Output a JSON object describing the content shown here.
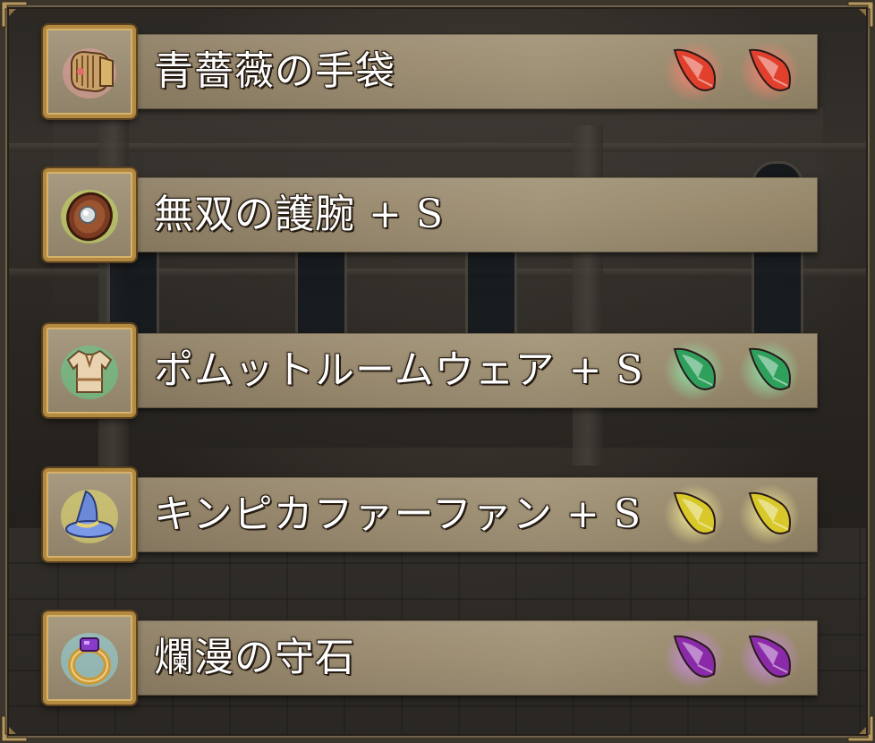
{
  "equipment_list": {
    "items": [
      {
        "name": "青薔薇の手袋",
        "icon": "gauntlet-icon",
        "icon_glow": "#e8a0a0",
        "gem_color": "red",
        "gem_count": 2,
        "gem_fill": "#e0402c",
        "gem_glow": "#ff8070"
      },
      {
        "name": "無双の護腕 + S",
        "icon": "shield-icon",
        "icon_glow": "#c8e060",
        "gem_color": "none",
        "gem_count": 0,
        "gem_fill": "",
        "gem_glow": ""
      },
      {
        "name": "ポムットルームウェア + S",
        "icon": "tunic-icon",
        "icon_glow": "#5fcf8a",
        "gem_color": "green",
        "gem_count": 2,
        "gem_fill": "#2f9f5c",
        "gem_glow": "#8ff0b0"
      },
      {
        "name": "キンピカファーファン + S",
        "icon": "wizard-hat-icon",
        "icon_glow": "#e8e070",
        "gem_color": "yellow",
        "gem_count": 2,
        "gem_fill": "#d8c82a",
        "gem_glow": "#fff59a"
      },
      {
        "name": "爛漫の守石",
        "icon": "ring-icon",
        "icon_glow": "#8fd8e8",
        "gem_color": "purple",
        "gem_count": 2,
        "gem_fill": "#8a2aa8",
        "gem_glow": "#d08af0"
      }
    ]
  },
  "colors": {
    "plate": "#9c8d72",
    "icon_border": "#b3893f",
    "text": "#ffffff"
  }
}
